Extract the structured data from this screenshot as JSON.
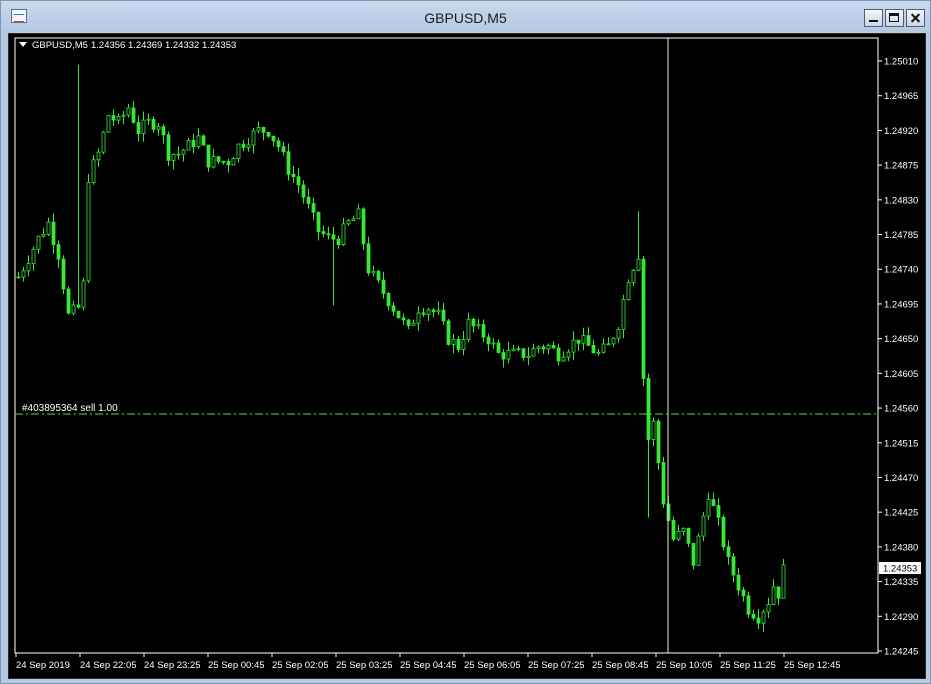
{
  "window": {
    "title": "GBPUSD,M5"
  },
  "chart": {
    "header_symbol": "GBPUSD,M5",
    "header_ohlc": "1.24356 1.24369 1.24332 1.24353",
    "order_label": "#403895364 sell 1.00",
    "current_price_label": "1.24353",
    "colors": {
      "background": "#000000",
      "candle": "#39e639",
      "axis": "#ffffff",
      "order_line": "#66cc66",
      "cursor_line": "#e8e8c0"
    }
  },
  "chart_data": {
    "type": "candlestick",
    "symbol": "GBPUSD",
    "timeframe": "M5",
    "y_ticks": [
      "1.25010",
      "1.24965",
      "1.24920",
      "1.24875",
      "1.24830",
      "1.24785",
      "1.24740",
      "1.24695",
      "1.24650",
      "1.24605",
      "1.24560",
      "1.24515",
      "1.24470",
      "1.24425",
      "1.24380",
      "1.24335",
      "1.24290",
      "1.24245"
    ],
    "x_ticks": [
      "24 Sep 2019",
      "24 Sep 22:05",
      "24 Sep 23:25",
      "25 Sep 00:45",
      "25 Sep 02:05",
      "25 Sep 03:25",
      "25 Sep 04:45",
      "25 Sep 06:05",
      "25 Sep 07:25",
      "25 Sep 08:45",
      "25 Sep 10:05",
      "25 Sep 11:25",
      "25 Sep 12:45"
    ],
    "ylim": [
      1.2424,
      1.2503
    ],
    "order_price": 1.24555,
    "last_price": 1.24353,
    "close_path": [
      [
        0,
        1.2473
      ],
      [
        4,
        1.2478
      ],
      [
        6,
        1.248
      ],
      [
        8,
        1.2476
      ],
      [
        10,
        1.2468
      ],
      [
        12,
        1.2469
      ],
      [
        13,
        1.2472
      ],
      [
        14,
        1.2486
      ],
      [
        16,
        1.2489
      ],
      [
        18,
        1.2494
      ],
      [
        20,
        1.2493
      ],
      [
        22,
        1.2495
      ],
      [
        24,
        1.2492
      ],
      [
        26,
        1.2493
      ],
      [
        28,
        1.2493
      ],
      [
        30,
        1.2489
      ],
      [
        32,
        1.2489
      ],
      [
        34,
        1.249
      ],
      [
        36,
        1.2491
      ],
      [
        38,
        1.2488
      ],
      [
        40,
        1.2488
      ],
      [
        42,
        1.2488
      ],
      [
        44,
        1.249
      ],
      [
        46,
        1.2491
      ],
      [
        48,
        1.2492
      ],
      [
        50,
        1.2492
      ],
      [
        52,
        1.249
      ],
      [
        54,
        1.2487
      ],
      [
        56,
        1.2485
      ],
      [
        58,
        1.2482
      ],
      [
        60,
        1.2479
      ],
      [
        62,
        1.2478
      ],
      [
        64,
        1.2478
      ],
      [
        66,
        1.248
      ],
      [
        68,
        1.2481
      ],
      [
        70,
        1.2474
      ],
      [
        72,
        1.2472
      ],
      [
        74,
        1.247
      ],
      [
        76,
        1.2468
      ],
      [
        78,
        1.2466
      ],
      [
        80,
        1.2469
      ],
      [
        82,
        1.2469
      ],
      [
        84,
        1.2468
      ],
      [
        86,
        1.2465
      ],
      [
        88,
        1.2464
      ],
      [
        90,
        1.2467
      ],
      [
        92,
        1.2466
      ],
      [
        94,
        1.2465
      ],
      [
        96,
        1.2463
      ],
      [
        98,
        1.2463
      ],
      [
        100,
        1.2463
      ],
      [
        102,
        1.2463
      ],
      [
        104,
        1.2464
      ],
      [
        106,
        1.2464
      ],
      [
        108,
        1.2463
      ],
      [
        110,
        1.2464
      ],
      [
        112,
        1.2465
      ],
      [
        114,
        1.2464
      ],
      [
        116,
        1.2463
      ],
      [
        118,
        1.2464
      ],
      [
        120,
        1.2467
      ],
      [
        122,
        1.2473
      ],
      [
        124,
        1.2476
      ],
      [
        125,
        1.246
      ],
      [
        126,
        1.2452
      ],
      [
        127,
        1.2454
      ],
      [
        129,
        1.2444
      ],
      [
        131,
        1.2439
      ],
      [
        133,
        1.244
      ],
      [
        135,
        1.2436
      ],
      [
        137,
        1.2442
      ],
      [
        138,
        1.2445
      ],
      [
        140,
        1.2441
      ],
      [
        142,
        1.2436
      ],
      [
        144,
        1.2433
      ],
      [
        146,
        1.243
      ],
      [
        148,
        1.2429
      ],
      [
        150,
        1.2431
      ],
      [
        151,
        1.2433
      ],
      [
        152,
        1.2432
      ],
      [
        153,
        1.2435
      ]
    ]
  }
}
